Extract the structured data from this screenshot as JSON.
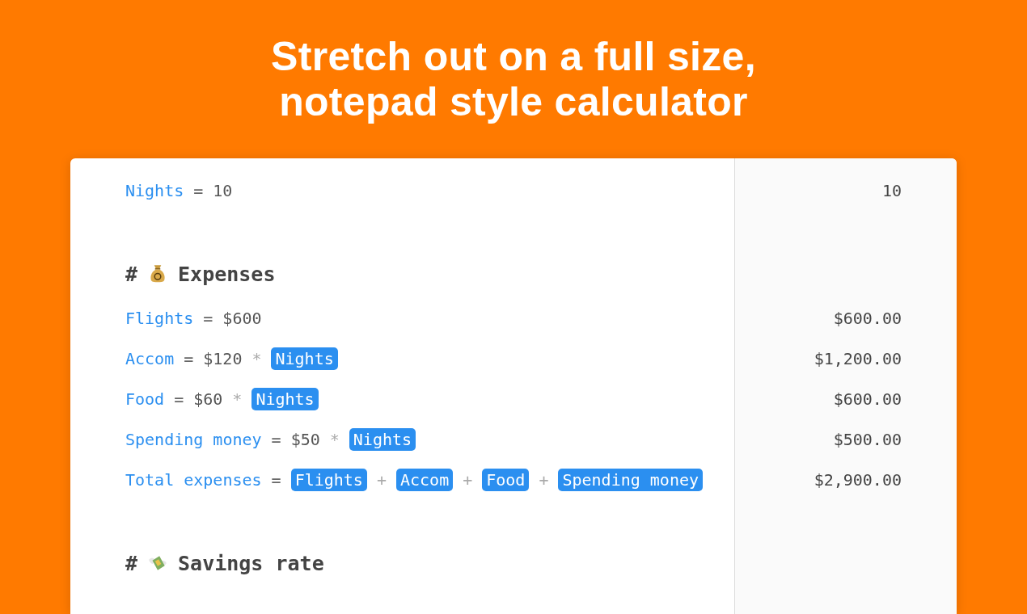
{
  "headline": [
    "Stretch out on a full size,",
    "notepad style calculator"
  ],
  "rows": [
    {
      "kind": "variable",
      "name": "Nights",
      "tokens": [
        {
          "kind": "assign",
          "text": "="
        },
        {
          "kind": "number",
          "text": "10"
        }
      ],
      "result": "10"
    },
    {
      "kind": "blank"
    },
    {
      "kind": "heading",
      "hash": "#",
      "title": "Expenses"
    },
    {
      "kind": "variable",
      "name": "Flights",
      "tokens": [
        {
          "kind": "assign",
          "text": "="
        },
        {
          "kind": "number",
          "text": "$600"
        }
      ],
      "result": "$600.00"
    },
    {
      "kind": "variable",
      "name": "Accom",
      "tokens": [
        {
          "kind": "assign",
          "text": "="
        },
        {
          "kind": "number",
          "text": "$120"
        },
        {
          "kind": "operator",
          "text": "*"
        },
        {
          "kind": "ref",
          "text": "Nights"
        }
      ],
      "result": "$1,200.00"
    },
    {
      "kind": "variable",
      "name": "Food",
      "tokens": [
        {
          "kind": "assign",
          "text": "="
        },
        {
          "kind": "number",
          "text": "$60"
        },
        {
          "kind": "operator",
          "text": "*"
        },
        {
          "kind": "ref",
          "text": "Nights"
        }
      ],
      "result": "$600.00"
    },
    {
      "kind": "variable",
      "name": "Spending money",
      "tokens": [
        {
          "kind": "assign",
          "text": "="
        },
        {
          "kind": "number",
          "text": "$50"
        },
        {
          "kind": "operator",
          "text": "*"
        },
        {
          "kind": "ref",
          "text": "Nights"
        }
      ],
      "result": "$500.00"
    },
    {
      "kind": "variable",
      "name": "Total expenses",
      "tokens": [
        {
          "kind": "assign",
          "text": "="
        },
        {
          "kind": "ref",
          "text": "Flights"
        },
        {
          "kind": "operator",
          "text": "+"
        },
        {
          "kind": "ref",
          "text": "Accom"
        },
        {
          "kind": "operator",
          "text": "+"
        },
        {
          "kind": "ref",
          "text": "Food"
        },
        {
          "kind": "operator",
          "text": "+"
        },
        {
          "kind": "ref",
          "text": "Spending money"
        }
      ],
      "result": "$2,900.00"
    },
    {
      "kind": "blank"
    },
    {
      "kind": "heading",
      "hash": "#",
      "title": "Savings rate"
    }
  ]
}
